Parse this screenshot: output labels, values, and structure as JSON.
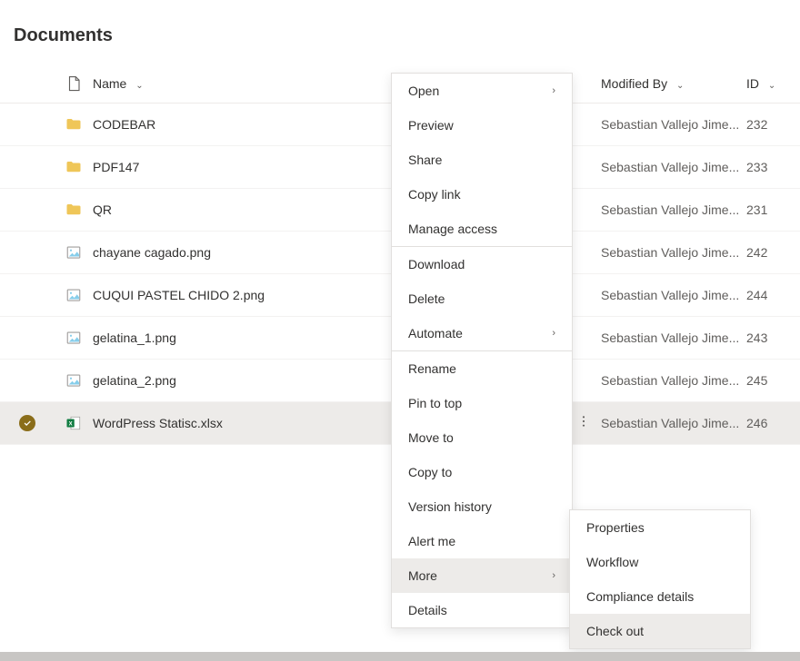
{
  "page_title": "Documents",
  "columns": {
    "name": "Name",
    "modified_by": "Modified By",
    "id": "ID"
  },
  "rows": [
    {
      "type": "folder",
      "name": "CODEBAR",
      "modified_by": "Sebastian Vallejo Jime...",
      "id": "232"
    },
    {
      "type": "folder",
      "name": "PDF147",
      "modified_by": "Sebastian Vallejo Jime...",
      "id": "233"
    },
    {
      "type": "folder",
      "name": "QR",
      "modified_by": "Sebastian Vallejo Jime...",
      "id": "231"
    },
    {
      "type": "image",
      "name": "chayane cagado.png",
      "modified_by": "Sebastian Vallejo Jime...",
      "id": "242"
    },
    {
      "type": "image",
      "name": "CUQUI PASTEL CHIDO 2.png",
      "modified_by": "Sebastian Vallejo Jime...",
      "id": "244"
    },
    {
      "type": "image",
      "name": "gelatina_1.png",
      "modified_by": "Sebastian Vallejo Jime...",
      "id": "243"
    },
    {
      "type": "image",
      "name": "gelatina_2.png",
      "modified_by": "Sebastian Vallejo Jime...",
      "id": "245"
    },
    {
      "type": "excel",
      "name": "WordPress Statisc.xlsx",
      "modified_by": "Sebastian Vallejo Jime...",
      "id": "246",
      "selected": true
    }
  ],
  "context_menu": {
    "open": "Open",
    "preview": "Preview",
    "share": "Share",
    "copy_link": "Copy link",
    "manage_access": "Manage access",
    "download": "Download",
    "delete": "Delete",
    "automate": "Automate",
    "rename": "Rename",
    "pin_to_top": "Pin to top",
    "move_to": "Move to",
    "copy_to": "Copy to",
    "version_history": "Version history",
    "alert_me": "Alert me",
    "more": "More",
    "details": "Details"
  },
  "submenu": {
    "properties": "Properties",
    "workflow": "Workflow",
    "compliance": "Compliance details",
    "check_out": "Check out"
  }
}
